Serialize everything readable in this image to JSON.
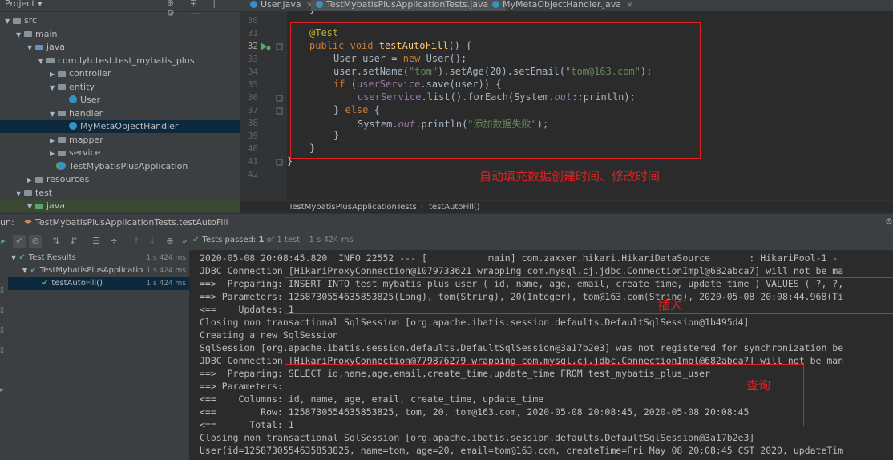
{
  "project": {
    "title": "Project ▾",
    "header_icons": "⊕ ∓ | ⚙ —",
    "tree": [
      {
        "label": "src",
        "level": 0,
        "kind": "folder",
        "arrow": "▼"
      },
      {
        "label": "main",
        "level": 1,
        "kind": "folder",
        "arrow": "▼"
      },
      {
        "label": "java",
        "level": 2,
        "kind": "folder-blue",
        "arrow": "▼"
      },
      {
        "label": "com.lyh.test.test_mybatis_plus",
        "level": 3,
        "kind": "folder",
        "arrow": "▼"
      },
      {
        "label": "controller",
        "level": 4,
        "kind": "folder",
        "arrow": "▶"
      },
      {
        "label": "entity",
        "level": 4,
        "kind": "folder",
        "arrow": "▼"
      },
      {
        "label": "User",
        "level": 5,
        "kind": "class",
        "arrow": ""
      },
      {
        "label": "handler",
        "level": 4,
        "kind": "folder",
        "arrow": "▼"
      },
      {
        "label": "MyMetaObjectHandler",
        "level": 5,
        "kind": "class",
        "arrow": "",
        "selected": true
      },
      {
        "label": "mapper",
        "level": 4,
        "kind": "folder",
        "arrow": "▶"
      },
      {
        "label": "service",
        "level": 4,
        "kind": "folder",
        "arrow": "▶"
      },
      {
        "label": "TestMybatisPlusApplication",
        "level": 4,
        "kind": "class-test",
        "arrow": ""
      },
      {
        "label": "resources",
        "level": 2,
        "kind": "folder",
        "arrow": "▶"
      },
      {
        "label": "test",
        "level": 1,
        "kind": "folder",
        "arrow": "▼"
      },
      {
        "label": "java",
        "level": 2,
        "kind": "folder-green",
        "arrow": "▼",
        "green": true
      }
    ]
  },
  "tabs": [
    {
      "label": "User.java",
      "active": false
    },
    {
      "label": "TestMybatisPlusApplicationTests.java",
      "active": true
    },
    {
      "label": "MyMetaObjectHandler.java",
      "active": false
    }
  ],
  "editor": {
    "line_numbers": [
      "30",
      "31",
      "32",
      "33",
      "34",
      "35",
      "36",
      "37",
      "38",
      "39",
      "40",
      "41",
      "42"
    ],
    "top_fragment": "}",
    "code": {
      "annotation": "@Test",
      "kw_public": "public",
      "kw_void": "void",
      "method_name": "testAutoFill",
      "sig_rest": "() {",
      "l33_a": "User user = ",
      "kw_new": "new",
      "l33_b": " User();",
      "l34_a": "user.setName(",
      "l34_str1": "\"tom\"",
      "l34_b": ").setAge(20).setEmail(",
      "l34_str2": "\"tom@163.com\"",
      "l34_c": ");",
      "kw_if": "if",
      "l35_a": " (",
      "l35_field": "userService",
      "l35_b": ".save(user)) {",
      "l36_field": "userService",
      "l36_a": ".list().forEach(System.",
      "l36_out": "out",
      "l36_b": "::println);",
      "l37_a": "} ",
      "kw_else": "else",
      "l37_b": " {",
      "l38_a": "System.",
      "l38_out": "out",
      "l38_b": ".println(",
      "l38_str": "\"添加数据失败\"",
      "l38_c": ");",
      "l39": "}",
      "l40": "}",
      "l41": "}"
    },
    "annotation_text": "自动填充数据创建时间、修改时间"
  },
  "breadcrumb": {
    "class_name": "TestMybatisPlusApplicationTests",
    "separator": "›",
    "method": "testAutoFill()"
  },
  "run": {
    "label": "un:",
    "config_name": "TestMybatisPlusApplicationTests.testAutoFill",
    "status_prefix": "Tests passed:",
    "status_count": "1",
    "status_rest": "of 1 test – 1 s 424 ms",
    "results": [
      {
        "label": "Test Results",
        "time": "1 s 424 ms",
        "level": 0
      },
      {
        "label": "TestMybatisPlusApplicatio",
        "time": "1 s 424 ms",
        "level": 1
      },
      {
        "label": "testAutoFill()",
        "time": "1 s 424 ms",
        "level": 2,
        "selected": true
      }
    ],
    "console": [
      "2020-05-08 20:08:45.820  INFO 22552 --- [           main] com.zaxxer.hikari.HikariDataSource       : HikariPool-1 -",
      "JDBC Connection [HikariProxyConnection@1079733621 wrapping com.mysql.cj.jdbc.ConnectionImpl@682abca7] will not be ma",
      "==>  Preparing: INSERT INTO test_mybatis_plus_user ( id, name, age, email, create_time, update_time ) VALUES ( ?, ?,",
      "==> Parameters: 1258730554635853825(Long), tom(String), 20(Integer), tom@163.com(String), 2020-05-08 20:08:44.968(Ti",
      "<==    Updates: 1",
      "Closing non transactional SqlSession [org.apache.ibatis.session.defaults.DefaultSqlSession@1b495d4]",
      "Creating a new SqlSession",
      "SqlSession [org.apache.ibatis.session.defaults.DefaultSqlSession@3a17b2e3] was not registered for synchronization be",
      "JDBC Connection [HikariProxyConnection@779876279 wrapping com.mysql.cj.jdbc.ConnectionImpl@682abca7] will not be man",
      "==>  Preparing: SELECT id,name,age,email,create_time,update_time FROM test_mybatis_plus_user",
      "==> Parameters: ",
      "<==    Columns: id, name, age, email, create_time, update_time",
      "<==        Row: 1258730554635853825, tom, 20, tom@163.com, 2020-05-08 20:08:45, 2020-05-08 20:08:45",
      "<==      Total: 1",
      "Closing non transactional SqlSession [org.apache.ibatis.session.defaults.DefaultSqlSession@3a17b2e3]",
      "User(id=1258730554635853825, name=tom, age=20, email=tom@163.com, createTime=Fri May 08 20:08:45 CST 2020, updateTim"
    ],
    "note_insert": "插入",
    "note_query": "查询"
  },
  "colors": {
    "annotation_red": "#e02020",
    "pass_green": "#59a869",
    "selection_blue": "#0d293e"
  }
}
